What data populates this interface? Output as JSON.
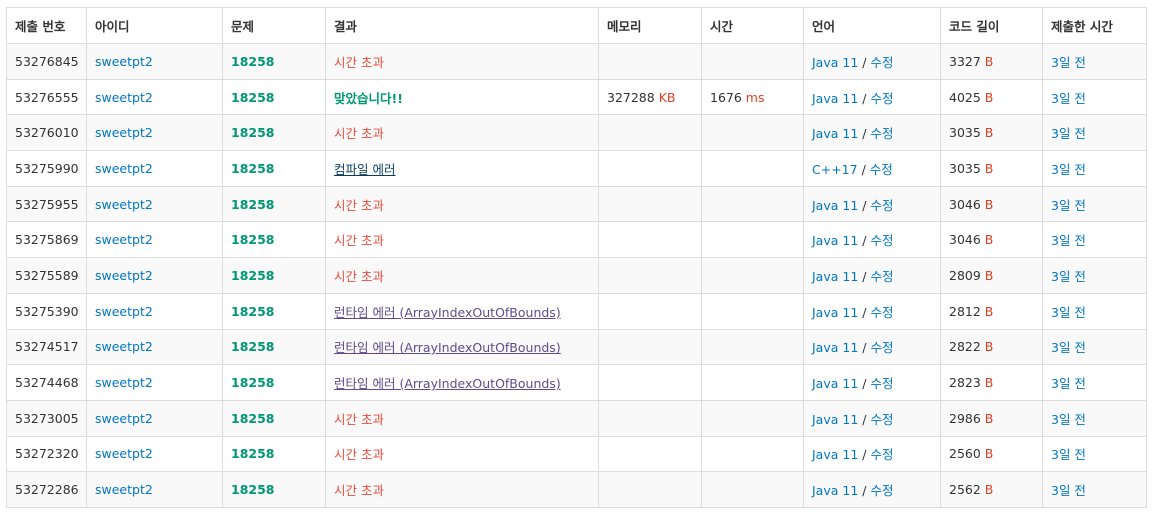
{
  "headers": [
    "제출 번호",
    "아이디",
    "문제",
    "결과",
    "메모리",
    "시간",
    "언어",
    "코드 길이",
    "제출한 시간"
  ],
  "units": {
    "memory": "KB",
    "time": "ms",
    "code": "B"
  },
  "edit_label": "수정",
  "colors": {
    "link": "#0076c0",
    "problem": "#009874",
    "tle": "#e74c3c",
    "accepted": "#009874",
    "compile_error": "#0b3c5d",
    "runtime_error": "#5f4b8b",
    "unit": "#dd4124"
  },
  "rows": [
    {
      "id": "53276845",
      "user": "sweetpt2",
      "problem": "18258",
      "result": "시간 초과",
      "result_type": "tle",
      "memory": "",
      "time": "",
      "lang": "Java 11",
      "code": "3327",
      "submitted": "3일 전"
    },
    {
      "id": "53276555",
      "user": "sweetpt2",
      "problem": "18258",
      "result": "맞았습니다!!",
      "result_type": "ac",
      "memory": "327288",
      "time": "1676",
      "lang": "Java 11",
      "code": "4025",
      "submitted": "3일 전"
    },
    {
      "id": "53276010",
      "user": "sweetpt2",
      "problem": "18258",
      "result": "시간 초과",
      "result_type": "tle",
      "memory": "",
      "time": "",
      "lang": "Java 11",
      "code": "3035",
      "submitted": "3일 전"
    },
    {
      "id": "53275990",
      "user": "sweetpt2",
      "problem": "18258",
      "result": "컴파일 에러",
      "result_type": "ce",
      "memory": "",
      "time": "",
      "lang": "C++17",
      "code": "3035",
      "submitted": "3일 전"
    },
    {
      "id": "53275955",
      "user": "sweetpt2",
      "problem": "18258",
      "result": "시간 초과",
      "result_type": "tle",
      "memory": "",
      "time": "",
      "lang": "Java 11",
      "code": "3046",
      "submitted": "3일 전"
    },
    {
      "id": "53275869",
      "user": "sweetpt2",
      "problem": "18258",
      "result": "시간 초과",
      "result_type": "tle",
      "memory": "",
      "time": "",
      "lang": "Java 11",
      "code": "3046",
      "submitted": "3일 전"
    },
    {
      "id": "53275589",
      "user": "sweetpt2",
      "problem": "18258",
      "result": "시간 초과",
      "result_type": "tle",
      "memory": "",
      "time": "",
      "lang": "Java 11",
      "code": "2809",
      "submitted": "3일 전"
    },
    {
      "id": "53275390",
      "user": "sweetpt2",
      "problem": "18258",
      "result": "런타임 에러 (ArrayIndexOutOfBounds)",
      "result_type": "re",
      "memory": "",
      "time": "",
      "lang": "Java 11",
      "code": "2812",
      "submitted": "3일 전"
    },
    {
      "id": "53274517",
      "user": "sweetpt2",
      "problem": "18258",
      "result": "런타임 에러 (ArrayIndexOutOfBounds)",
      "result_type": "re",
      "memory": "",
      "time": "",
      "lang": "Java 11",
      "code": "2822",
      "submitted": "3일 전"
    },
    {
      "id": "53274468",
      "user": "sweetpt2",
      "problem": "18258",
      "result": "런타임 에러 (ArrayIndexOutOfBounds)",
      "result_type": "re",
      "memory": "",
      "time": "",
      "lang": "Java 11",
      "code": "2823",
      "submitted": "3일 전"
    },
    {
      "id": "53273005",
      "user": "sweetpt2",
      "problem": "18258",
      "result": "시간 초과",
      "result_type": "tle",
      "memory": "",
      "time": "",
      "lang": "Java 11",
      "code": "2986",
      "submitted": "3일 전"
    },
    {
      "id": "53272320",
      "user": "sweetpt2",
      "problem": "18258",
      "result": "시간 초과",
      "result_type": "tle",
      "memory": "",
      "time": "",
      "lang": "Java 11",
      "code": "2560",
      "submitted": "3일 전"
    },
    {
      "id": "53272286",
      "user": "sweetpt2",
      "problem": "18258",
      "result": "시간 초과",
      "result_type": "tle",
      "memory": "",
      "time": "",
      "lang": "Java 11",
      "code": "2562",
      "submitted": "3일 전"
    }
  ]
}
